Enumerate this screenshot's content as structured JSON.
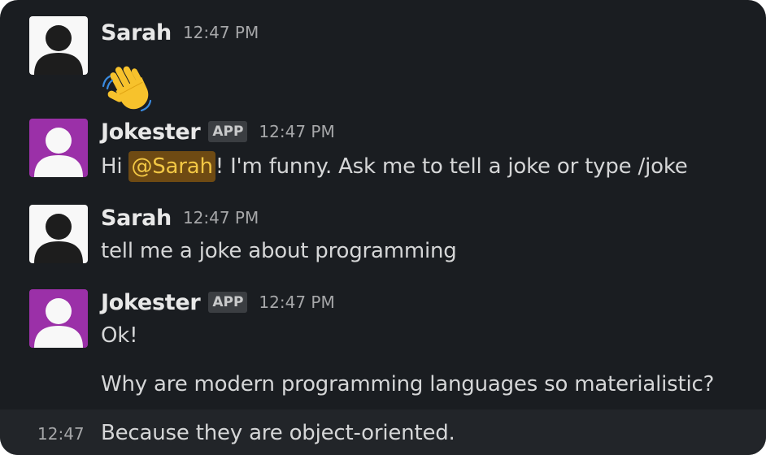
{
  "messages": [
    {
      "author": "Sarah",
      "time": "12:47 PM",
      "reaction_emoji": "waving-hand",
      "avatar_color": "#f8f8f8"
    },
    {
      "author": "Jokester",
      "badge": "APP",
      "time": "12:47 PM",
      "text_before": "Hi ",
      "mention": "@Sarah",
      "text_after": "! I'm funny. Ask me to tell a joke or type /joke",
      "avatar_color": "#9b30a8"
    },
    {
      "author": "Sarah",
      "time": "12:47 PM",
      "text": "tell me a joke about programming",
      "avatar_color": "#f8f8f8"
    },
    {
      "author": "Jokester",
      "badge": "APP",
      "time": "12:47 PM",
      "lines": [
        "Ok!",
        "Why are modern programming languages so materialistic?"
      ],
      "avatar_color": "#9b30a8"
    }
  ],
  "continuation": {
    "time": "12:47",
    "text": "Because they are object-oriented."
  },
  "colors": {
    "background": "#1a1d21",
    "hover_row": "#222529",
    "mention_bg": "#6e4a13",
    "mention_fg": "#f2c744"
  }
}
